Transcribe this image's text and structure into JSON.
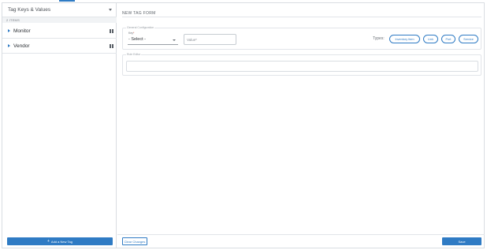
{
  "sidebar": {
    "title": "Tag Keys & Values",
    "count": "2 ITEMS",
    "items": [
      {
        "label": "Monitor"
      },
      {
        "label": "Vendor"
      }
    ],
    "add_button": "Add a New Tag"
  },
  "form": {
    "title": "NEW TAG FORM",
    "general_legend": "General Configuration",
    "key_label": "Key",
    "key_required": "*",
    "key_value": "- Select -",
    "value_placeholder": "Value*",
    "types_label": "Types:",
    "types": [
      "Inventory Item",
      "Link",
      "Port",
      "Service"
    ],
    "rule_legend": "Rule Editor"
  },
  "footer": {
    "clear_label": "Clear Changes",
    "save_label": "Save"
  },
  "colors": {
    "accent": "#2f7bc4",
    "border": "#d9dde2"
  }
}
